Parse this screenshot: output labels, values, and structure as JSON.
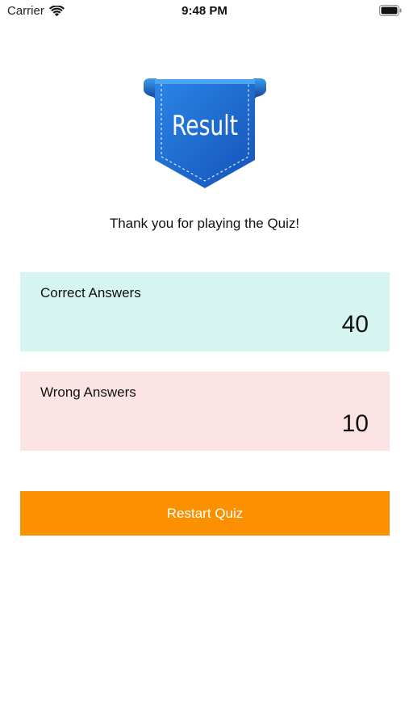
{
  "status_bar": {
    "carrier": "Carrier",
    "time": "9:48 PM",
    "icons": [
      "wifi-icon",
      "battery-icon"
    ]
  },
  "badge": {
    "label": "Result",
    "color": "#1f6fd6"
  },
  "message": "Thank you for playing the Quiz!",
  "results": {
    "correct": {
      "label": "Correct Answers",
      "value": "40",
      "color": "#d6f5f1"
    },
    "wrong": {
      "label": "Wrong Answers",
      "value": "10",
      "color": "#fde4e4"
    }
  },
  "restart_button": {
    "label": "Restart Quiz",
    "color": "#fb9100"
  }
}
